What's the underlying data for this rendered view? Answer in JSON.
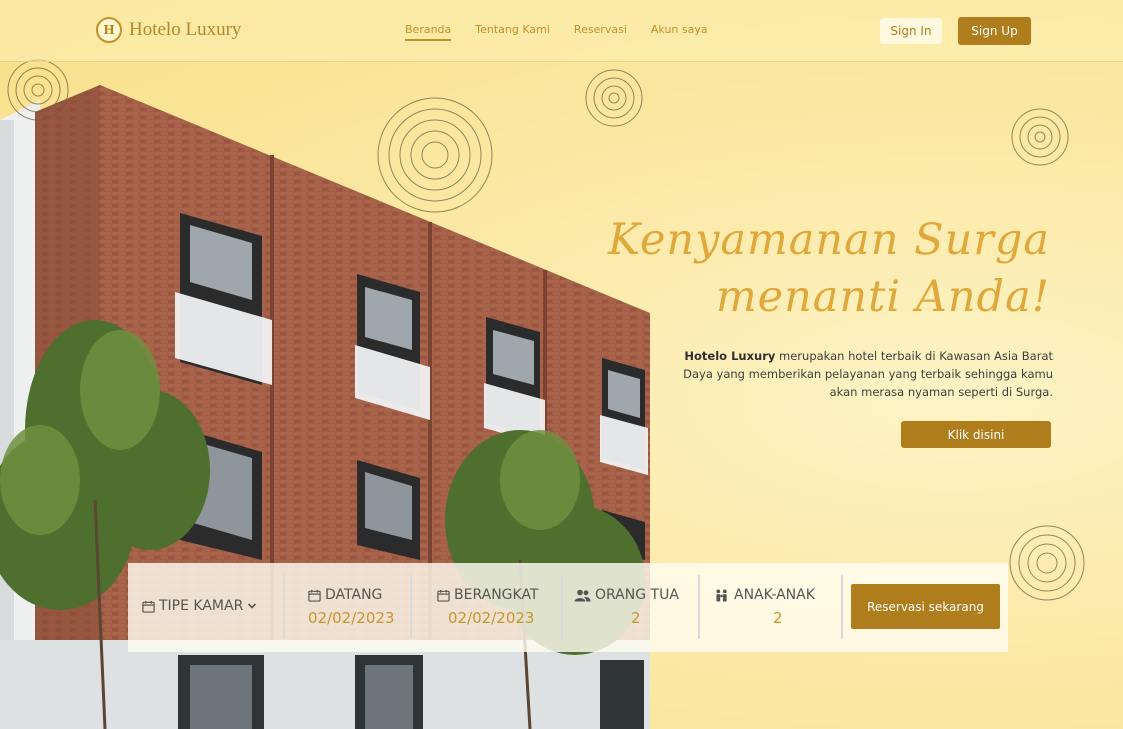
{
  "brand": {
    "logo_text": "H",
    "name": "Hotelo Luxury"
  },
  "nav": {
    "items": [
      {
        "label": "Beranda",
        "active": true
      },
      {
        "label": "Tentang Kami",
        "active": false
      },
      {
        "label": "Reservasi",
        "active": false
      },
      {
        "label": "Akun saya",
        "active": false
      }
    ],
    "sign_in": "Sign In",
    "sign_up": "Sign Up"
  },
  "hero": {
    "title_line1": "Kenyamanan Surga",
    "title_line2": "menanti Anda!",
    "desc_bold": "Hotelo Luxury",
    "desc_rest": " merupakan hotel terbaik di Kawasan Asia Barat Daya yang memberikan pelayanan yang terbaik sehingga kamu akan merasa nyaman seperti di Surga.",
    "cta": "Klik disini"
  },
  "booking": {
    "room_type": {
      "label": "TIPE KAMAR",
      "icon": "calendar-icon"
    },
    "checkin": {
      "label": "DATANG",
      "value": "02/02/2023",
      "icon": "calendar-icon"
    },
    "checkout": {
      "label": "BERANGKAT",
      "value": "02/02/2023",
      "icon": "calendar-icon"
    },
    "adults": {
      "label": "ORANG TUA",
      "value": "2",
      "icon": "people-icon"
    },
    "children": {
      "label": "ANAK-ANAK",
      "value": "2",
      "icon": "family-icon"
    },
    "submit": "Reservasi sekarang"
  },
  "colors": {
    "accent": "#b07d1c",
    "title": "#e0a83a",
    "value": "#c9962a",
    "background": "#fbe9a6"
  }
}
